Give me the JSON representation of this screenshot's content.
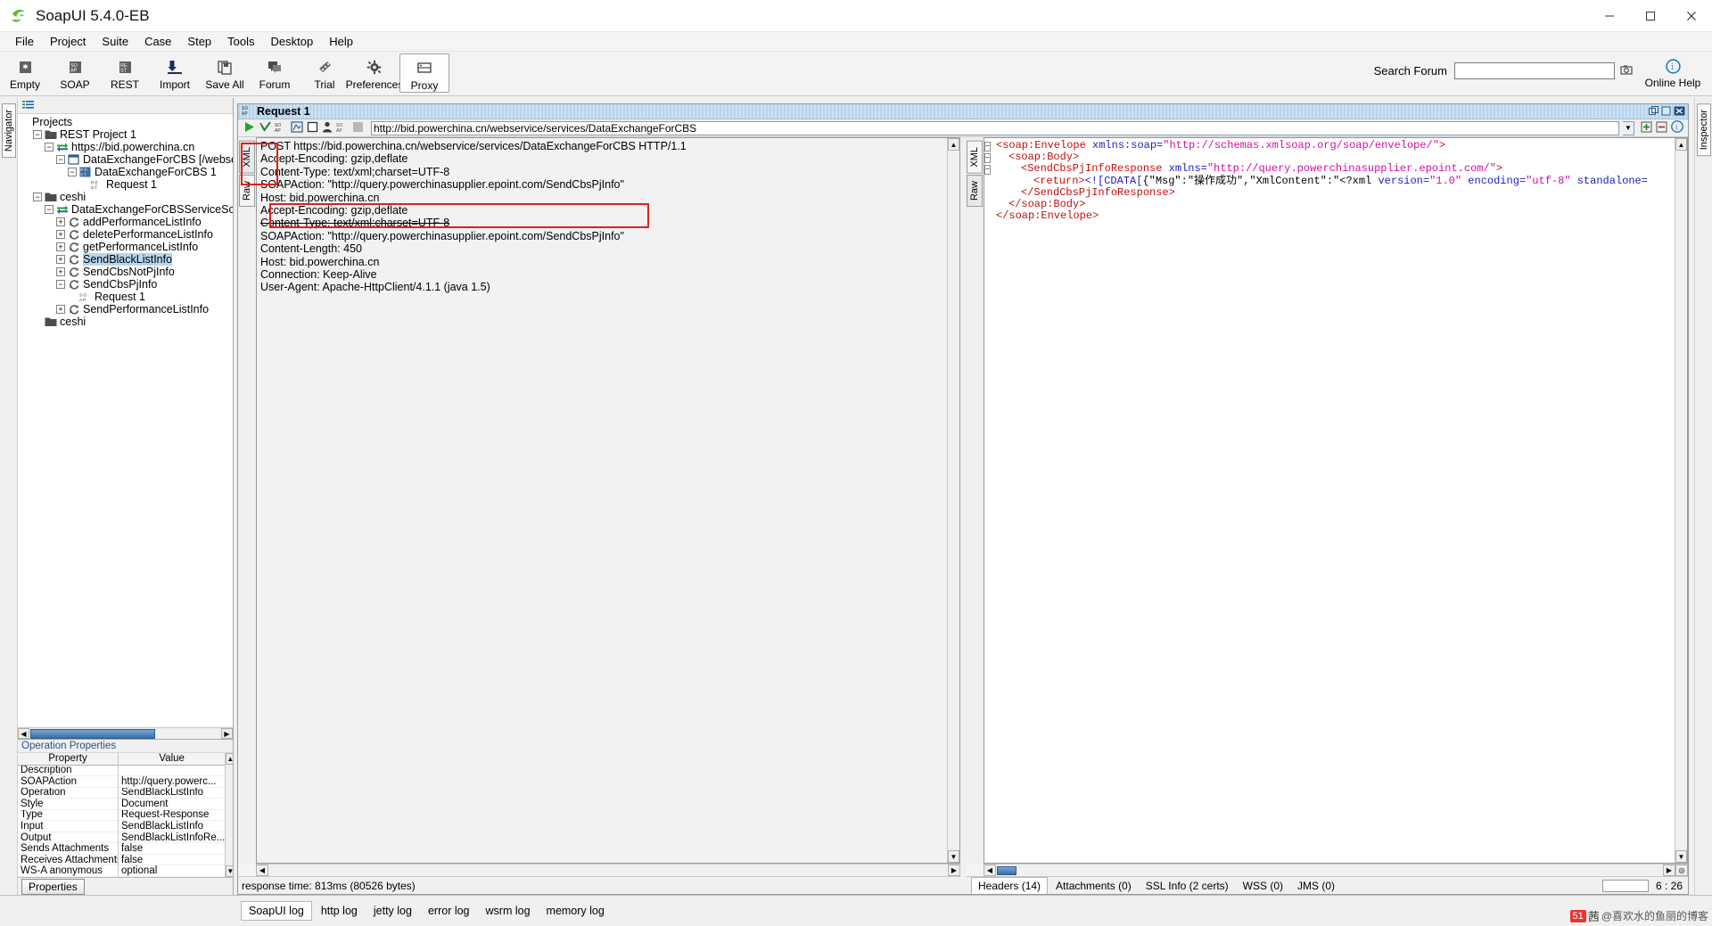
{
  "window": {
    "title": "SoapUI 5.4.0-EB",
    "controls": {
      "minimize": "─",
      "maximize": "❐",
      "close": "✕"
    }
  },
  "menubar": [
    {
      "label": "File"
    },
    {
      "label": "Project"
    },
    {
      "label": "Suite"
    },
    {
      "label": "Case"
    },
    {
      "label": "Step"
    },
    {
      "label": "Tools"
    },
    {
      "label": "Desktop"
    },
    {
      "label": "Help"
    }
  ],
  "toolbar": {
    "buttons": [
      {
        "label": "Empty",
        "icon": "empty-project-icon"
      },
      {
        "label": "SOAP",
        "icon": "soap-project-icon"
      },
      {
        "label": "REST",
        "icon": "rest-project-icon"
      },
      {
        "label": "Import",
        "icon": "import-icon"
      },
      {
        "label": "Save All",
        "icon": "save-all-icon"
      },
      {
        "label": "Forum",
        "icon": "forum-icon"
      },
      {
        "label": "Trial",
        "icon": "trial-icon"
      },
      {
        "label": "Preferences",
        "icon": "preferences-icon"
      },
      {
        "label": "Proxy",
        "icon": "proxy-icon"
      }
    ],
    "search_label": "Search Forum",
    "search_value": "",
    "online_help": "Online Help"
  },
  "left_strip": {
    "navigator_label": "Navigator"
  },
  "right_strip": {
    "inspector_label": "Inspector"
  },
  "navigator": {
    "root_label": "Projects",
    "tree": [
      {
        "label": "Projects",
        "depth": 0,
        "icon": "none",
        "expander": "none"
      },
      {
        "label": "REST Project 1",
        "depth": 1,
        "icon": "folder-icon",
        "expander": "minus"
      },
      {
        "label": "https://bid.powerchina.cn",
        "depth": 2,
        "icon": "interface-icon",
        "expander": "minus"
      },
      {
        "label": "DataExchangeForCBS [/webservice/",
        "depth": 3,
        "icon": "resource-icon",
        "expander": "minus"
      },
      {
        "label": "DataExchangeForCBS 1",
        "depth": 4,
        "icon": "post-icon",
        "expander": "minus"
      },
      {
        "label": "Request 1",
        "depth": 5,
        "icon": "rest-request-icon",
        "expander": "none"
      },
      {
        "label": "ceshi",
        "depth": 1,
        "icon": "folder-icon",
        "expander": "minus"
      },
      {
        "label": "DataExchangeForCBSServiceSoapBindi",
        "depth": 2,
        "icon": "interface-icon",
        "expander": "minus"
      },
      {
        "label": "addPerformanceListInfo",
        "depth": 3,
        "icon": "operation-icon",
        "expander": "plus"
      },
      {
        "label": "deletePerformanceListInfo",
        "depth": 3,
        "icon": "operation-icon",
        "expander": "plus"
      },
      {
        "label": "getPerformanceListInfo",
        "depth": 3,
        "icon": "operation-icon",
        "expander": "plus"
      },
      {
        "label": "SendBlackListInfo",
        "depth": 3,
        "icon": "operation-icon",
        "expander": "plus",
        "selected": true
      },
      {
        "label": "SendCbsNotPjInfo",
        "depth": 3,
        "icon": "operation-icon",
        "expander": "plus"
      },
      {
        "label": "SendCbsPjInfo",
        "depth": 3,
        "icon": "operation-icon",
        "expander": "minus"
      },
      {
        "label": "Request 1",
        "depth": 4,
        "icon": "soap-request-icon",
        "expander": "none"
      },
      {
        "label": "SendPerformanceListInfo",
        "depth": 3,
        "icon": "operation-icon",
        "expander": "plus"
      },
      {
        "label": "ceshi",
        "depth": 1,
        "icon": "folder-icon",
        "expander": "none"
      }
    ]
  },
  "operation_properties": {
    "title": "Operation Properties",
    "headers": {
      "property": "Property",
      "value": "Value"
    },
    "rows": [
      {
        "property": "Description",
        "value": ""
      },
      {
        "property": "SOAPAction",
        "value": "http://query.powerc..."
      },
      {
        "property": "Operation",
        "value": "SendBlackListInfo"
      },
      {
        "property": "Style",
        "value": "Document"
      },
      {
        "property": "Type",
        "value": "Request-Response"
      },
      {
        "property": "Input",
        "value": "SendBlackListInfo"
      },
      {
        "property": "Output",
        "value": "SendBlackListInfoRe..."
      },
      {
        "property": "Sends Attachments",
        "value": "false"
      },
      {
        "property": "Receives Attachments",
        "value": "false"
      },
      {
        "property": "WS-A anonymous",
        "value": "optional"
      }
    ],
    "button_label": "Properties"
  },
  "request_window": {
    "tab_title": "Request 1",
    "tab_icon": "soap-icon",
    "window_buttons": [
      {
        "icon": "restore-icon"
      },
      {
        "icon": "maximize-icon"
      },
      {
        "icon": "close-icon"
      }
    ],
    "toolbar_icons": [
      {
        "icon": "run-icon"
      },
      {
        "icon": "run-validate-icon"
      },
      {
        "icon": "soap-format-icon"
      },
      {
        "icon": "insert-wsa-icon"
      },
      {
        "icon": "stop-icon"
      },
      {
        "icon": "auth-icon"
      },
      {
        "icon": "soap-version-icon"
      },
      {
        "icon": "recording-icon"
      }
    ],
    "endpoint": "http://bid.powerchina.cn/webservice/services/DataExchangeForCBS",
    "endpoint_dropdown_icon": "chevron-down-icon",
    "right_toolbar_icons": [
      {
        "icon": "add-endpoint-icon"
      },
      {
        "icon": "remove-endpoint-icon"
      },
      {
        "icon": "help-icon"
      }
    ]
  },
  "request_editor": {
    "tabs": [
      {
        "label": "XML",
        "active": false
      },
      {
        "label": "Raw",
        "active": true
      }
    ],
    "raw_lines": [
      "POST https://bid.powerchina.cn/webservice/services/DataExchangeForCBS HTTP/1.1",
      "Accept-Encoding: gzip,deflate",
      "Content-Type: text/xml;charset=UTF-8",
      "SOAPAction: \"http://query.powerchinasupplier.epoint.com/SendCbsPjInfo\"",
      "Host: bid.powerchina.cn",
      "Accept-Encoding: gzip,deflate",
      "Content-Type: text/xml;charset=UTF-8",
      "SOAPAction: \"http://query.powerchinasupplier.epoint.com/SendCbsPjInfo\"",
      "Content-Length: 450",
      "Host: bid.powerchina.cn",
      "Connection: Keep-Alive",
      "User-Agent: Apache-HttpClient/4.1.1 (java 1.5)"
    ]
  },
  "response_editor": {
    "tabs": [
      {
        "label": "XML",
        "active": true
      },
      {
        "label": "Raw",
        "active": false
      }
    ],
    "xml_lines": [
      {
        "indent": 0,
        "fold": true,
        "parts": [
          {
            "t": "tag",
            "s": "<soap:Envelope "
          },
          {
            "t": "attr",
            "s": "xmlns:soap="
          },
          {
            "t": "val",
            "s": "\"http://schemas.xmlsoap.org/soap/envelope/\""
          },
          {
            "t": "tag",
            "s": ">"
          }
        ]
      },
      {
        "indent": 1,
        "fold": true,
        "parts": [
          {
            "t": "tag",
            "s": "<soap:Body>"
          }
        ]
      },
      {
        "indent": 2,
        "fold": true,
        "parts": [
          {
            "t": "tag",
            "s": "<SendCbsPjInfoResponse "
          },
          {
            "t": "attr",
            "s": "xmlns="
          },
          {
            "t": "val",
            "s": "\"http://query.powerchinasupplier.epoint.com/\""
          },
          {
            "t": "tag",
            "s": ">"
          }
        ]
      },
      {
        "indent": 3,
        "fold": false,
        "parts": [
          {
            "t": "tag",
            "s": "<return>"
          },
          {
            "t": "cd",
            "s": "<![CDATA["
          },
          {
            "t": "txt",
            "s": "{\"Msg\":\"操作成功\",\"XmlContent\":\"<?xml "
          },
          {
            "t": "attr",
            "s": "version="
          },
          {
            "t": "val",
            "s": "\"1.0\""
          },
          {
            "t": "attr",
            "s": " encoding="
          },
          {
            "t": "val",
            "s": "\"utf-8\""
          },
          {
            "t": "attr",
            "s": " standalone="
          }
        ]
      },
      {
        "indent": 2,
        "fold": false,
        "parts": [
          {
            "t": "tag",
            "s": "</SendCbsPjInfoResponse>"
          }
        ]
      },
      {
        "indent": 1,
        "fold": false,
        "parts": [
          {
            "t": "tag",
            "s": "</soap:Body>"
          }
        ]
      },
      {
        "indent": 0,
        "fold": false,
        "parts": [
          {
            "t": "tag",
            "s": "</soap:Envelope>"
          }
        ]
      }
    ]
  },
  "response_tabs": [
    {
      "label": "Headers (14)",
      "active": true
    },
    {
      "label": "Attachments (0)",
      "active": false
    },
    {
      "label": "SSL Info (2 certs)",
      "active": false
    },
    {
      "label": "WSS (0)",
      "active": false
    },
    {
      "label": "JMS (0)",
      "active": false
    }
  ],
  "response_status": "response time: 813ms (80526 bytes)",
  "caret_position": "6 : 26",
  "log_tabs": [
    {
      "label": "SoapUI log",
      "active": true
    },
    {
      "label": "http log",
      "active": false
    },
    {
      "label": "jetty log",
      "active": false
    },
    {
      "label": "error log",
      "active": false
    },
    {
      "label": "wsrm log",
      "active": false
    },
    {
      "label": "memory log",
      "active": false
    }
  ],
  "watermark": {
    "badge": "51",
    "word": "茜",
    "text": "@喜欢水的鱼丽的博客"
  },
  "colors": {
    "accent": "#3b6ea5",
    "selection": "#b5d5f0",
    "annotation": "#e12020",
    "xml_tag": "#c01010",
    "xml_attr": "#1c1cc0",
    "xml_value": "#d010a0",
    "green_run": "#27a327"
  }
}
